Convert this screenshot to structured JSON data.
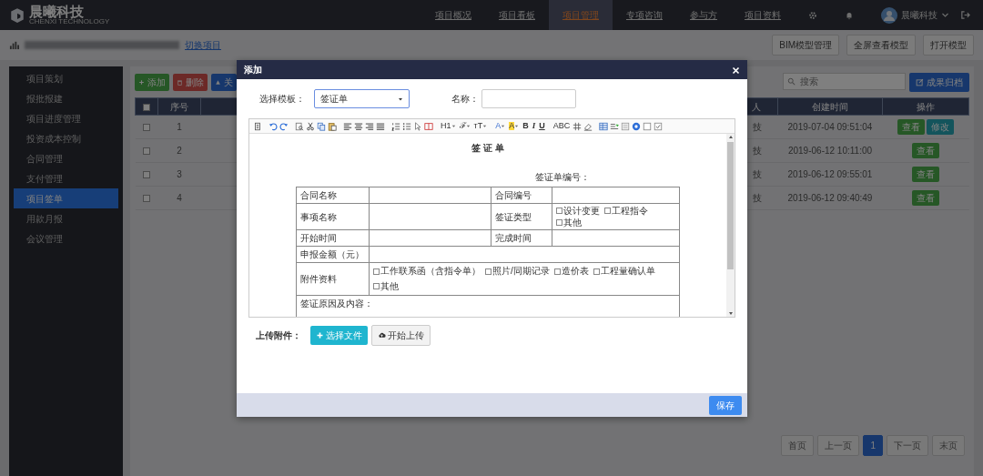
{
  "top_nav": {
    "logo_text": "晨曦科技",
    "logo_subtext": "CHENXI TECHNOLOGY",
    "menu": [
      {
        "label": "项目概况",
        "selected": false
      },
      {
        "label": "项目看板",
        "selected": false
      },
      {
        "label": "项目管理",
        "selected": true
      },
      {
        "label": "专项咨询",
        "selected": false
      },
      {
        "label": "参与方",
        "selected": false
      },
      {
        "label": "项目资料",
        "selected": false
      }
    ],
    "user": "晨曦科技"
  },
  "subheader": {
    "switch_link": "切换项目",
    "buttons": [
      "BIM模型管理",
      "全屏查看模型",
      "打开模型"
    ]
  },
  "sidebar": {
    "items": [
      {
        "label": "项目策划",
        "selected": false
      },
      {
        "label": "报批报建",
        "selected": false
      },
      {
        "label": "项目进度管理",
        "selected": false
      },
      {
        "label": "投资成本控制",
        "selected": false
      },
      {
        "label": "合同管理",
        "selected": false
      },
      {
        "label": "支付管理",
        "selected": false
      },
      {
        "label": "项目签单",
        "selected": true
      },
      {
        "label": "用款月报",
        "selected": false
      },
      {
        "label": "会议管理",
        "selected": false
      }
    ]
  },
  "toolbar": [
    {
      "label": "添加",
      "kind": "add"
    },
    {
      "label": "删除",
      "kind": "delete"
    },
    {
      "label": "关",
      "kind": "relate"
    }
  ],
  "search": {
    "placeholder": "搜索"
  },
  "archive_button": "成果归档",
  "table": {
    "columns": [
      "序号",
      "人",
      "创建时间",
      "操作"
    ],
    "header_checked": false,
    "rows": [
      {
        "checked": false,
        "cells": [
          "1",
          "技",
          "2019-07-04 09:51:04"
        ],
        "actions": [
          {
            "label": "查看",
            "kind": "view"
          },
          {
            "label": "修改",
            "kind": "edit"
          }
        ]
      },
      {
        "checked": false,
        "cells": [
          "2",
          "技",
          "2019-06-12 10:11:00"
        ],
        "actions": [
          {
            "label": "查看",
            "kind": "view"
          }
        ]
      },
      {
        "checked": false,
        "cells": [
          "3",
          "技",
          "2019-06-12 09:55:01"
        ],
        "actions": [
          {
            "label": "查看",
            "kind": "view"
          }
        ]
      },
      {
        "checked": false,
        "cells": [
          "4",
          "技",
          "2019-06-12 09:40:49"
        ],
        "actions": [
          {
            "label": "查看",
            "kind": "view"
          }
        ]
      }
    ]
  },
  "pagination": [
    {
      "label": "首页",
      "selected": false
    },
    {
      "label": "上一页",
      "selected": false
    },
    {
      "label": "1",
      "selected": true
    },
    {
      "label": "下一页",
      "selected": false
    },
    {
      "label": "末页",
      "selected": false
    }
  ],
  "modal": {
    "title": "添加",
    "template_label": "选择模板：",
    "template_value": "签证单",
    "name_label": "名称：",
    "editor_toolbar": [
      [
        {
          "kind": "icon"
        }
      ],
      [
        {
          "kind": "icon"
        },
        {
          "kind": "icon"
        }
      ],
      [
        {
          "kind": "icon"
        },
        {
          "kind": "icon"
        },
        {
          "kind": "icon"
        },
        {
          "kind": "icon"
        }
      ],
      [
        {
          "kind": "icon"
        },
        {
          "kind": "icon"
        },
        {
          "kind": "icon"
        },
        {
          "kind": "icon"
        }
      ],
      [
        {
          "kind": "icon"
        },
        {
          "kind": "icon"
        },
        {
          "kind": "icon"
        },
        {
          "kind": "icon"
        }
      ],
      [
        {
          "kind": "plain",
          "label": "H1",
          "dropdown": true
        },
        {
          "kind": "plain",
          "label": "ℱ",
          "dropdown": true
        },
        {
          "kind": "plain",
          "label": "тT",
          "dropdown": true
        }
      ],
      [
        {
          "kind": "font-color",
          "label": "A",
          "dropdown": true
        },
        {
          "kind": "highlight",
          "label": "A",
          "dropdown": true
        },
        {
          "kind": "bold",
          "label": "B",
          "dropdown": false
        },
        {
          "kind": "italic",
          "label": "I",
          "dropdown": false
        },
        {
          "kind": "underline",
          "label": "U",
          "dropdown": false
        }
      ],
      [
        {
          "kind": "plain",
          "label": "ABC",
          "dropdown": false
        },
        {
          "kind": "icon"
        },
        {
          "kind": "icon"
        }
      ],
      [
        {
          "kind": "icon"
        },
        {
          "kind": "icon"
        },
        {
          "kind": "icon"
        },
        {
          "kind": "icon"
        },
        {
          "kind": "icon"
        },
        {
          "kind": "icon"
        }
      ]
    ],
    "document": {
      "title": "签 证 单",
      "number_label": "签证单编号：",
      "rows": [
        [
          {
            "kind": "label",
            "text": "合同名称"
          },
          {
            "kind": "blank"
          },
          {
            "kind": "label",
            "text": "合同编号"
          },
          {
            "kind": "blank"
          }
        ],
        [
          {
            "kind": "label",
            "text": "事项名称"
          },
          {
            "kind": "blank"
          },
          {
            "kind": "label",
            "text": "签证类型"
          },
          {
            "kind": "options",
            "options": [
              {
                "label": "设计变更",
                "checked": false
              },
              {
                "label": "工程指令",
                "checked": false
              },
              {
                "label": "其他",
                "checked": false
              }
            ]
          }
        ],
        [
          {
            "kind": "label",
            "text": "开始时间"
          },
          {
            "kind": "blank"
          },
          {
            "kind": "label",
            "text": "完成时间"
          },
          {
            "kind": "blank"
          }
        ],
        [
          {
            "kind": "label",
            "text": "申报金额（元）"
          },
          {
            "kind": "wide-blank",
            "colspan": 3
          }
        ],
        [
          {
            "kind": "label",
            "text": "附件资料"
          },
          {
            "kind": "wide-options",
            "colspan": 3,
            "options": [
              {
                "label": "工作联系函（含指令单）",
                "checked": false
              },
              {
                "label": "照片/同期记录",
                "checked": false
              },
              {
                "label": "造价表",
                "checked": false
              },
              {
                "label": "工程量确认单",
                "checked": false
              },
              {
                "label": "其他",
                "checked": false
              }
            ]
          }
        ],
        [
          {
            "kind": "area",
            "colspan": 4,
            "text": "签证原因及内容："
          }
        ]
      ]
    },
    "upload_label": "上传附件：",
    "upload_buttons": [
      {
        "label": "选择文件",
        "kind": "choose"
      },
      {
        "label": "开始上传",
        "kind": "upload"
      }
    ],
    "save": "保存"
  }
}
